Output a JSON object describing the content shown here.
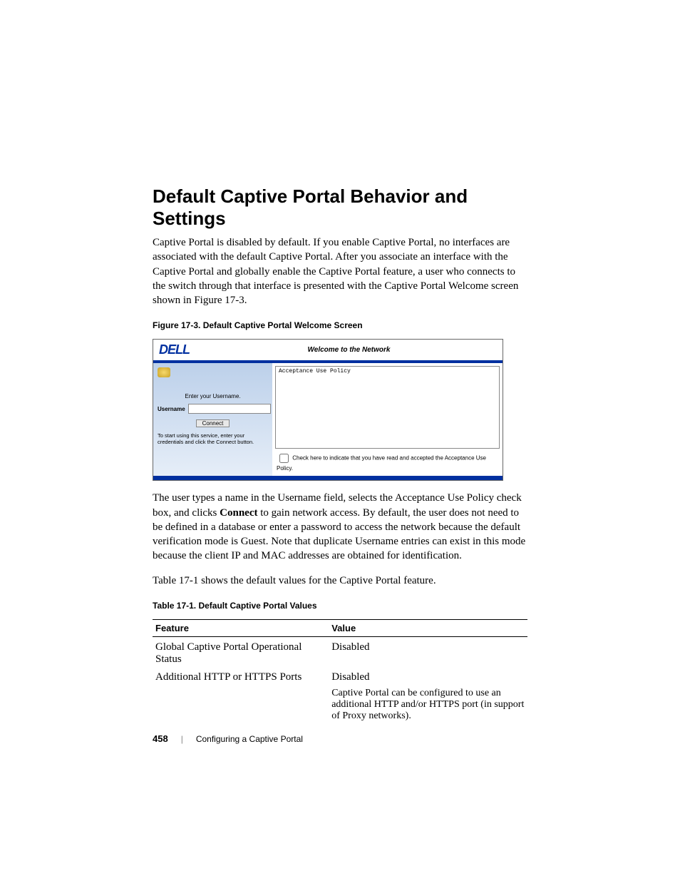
{
  "heading": "Default Captive Portal Behavior and Settings",
  "intro": "Captive Portal is disabled by default. If you enable Captive Portal, no interfaces are associated with the default Captive Portal. After you associate an interface with the Captive Portal and globally enable the Captive Portal feature, a user who connects to the switch through that interface is presented with the Captive Portal Welcome screen shown in Figure 17-3.",
  "figure_caption": "Figure 17-3.    Default Captive Portal Welcome Screen",
  "portal": {
    "logo": "DELL",
    "welcome": "Welcome to the Network",
    "enter_prompt": "Enter your Username.",
    "username_label": "Username",
    "connect_label": "Connect",
    "start_note": "To start using this service, enter your credentials and click the Connect button.",
    "policy_title": "Acceptance Use Policy",
    "checkbox_text": "Check here to indicate that you have read and accepted the Acceptance Use Policy."
  },
  "after_figure_p1_a": "The user types a name in the Username field, selects the Acceptance Use Policy check box, and clicks ",
  "after_figure_p1_bold": "Connect",
  "after_figure_p1_b": " to gain network access. By default, the user does not need to be defined in a database or enter a password to access the network because the default verification mode is Guest. Note that duplicate Username entries can exist in this mode because the client IP and MAC addresses are obtained for identification.",
  "after_figure_p2": "Table 17-1 shows the default values for the Captive Portal feature.",
  "table_caption": "Table 17-1.    Default Captive Portal Values",
  "table": {
    "head_feature": "Feature",
    "head_value": "Value",
    "r1_feature": "Global Captive Portal Operational Status",
    "r1_value": "Disabled",
    "r2_feature": "Additional HTTP or HTTPS Ports",
    "r2_value": "Disabled",
    "r2_note": "Captive Portal can be configured to use an additional HTTP and/or HTTPS port (in support of Proxy networks)."
  },
  "footer": {
    "page": "458",
    "sep": "|",
    "section": "Configuring a Captive Portal"
  }
}
